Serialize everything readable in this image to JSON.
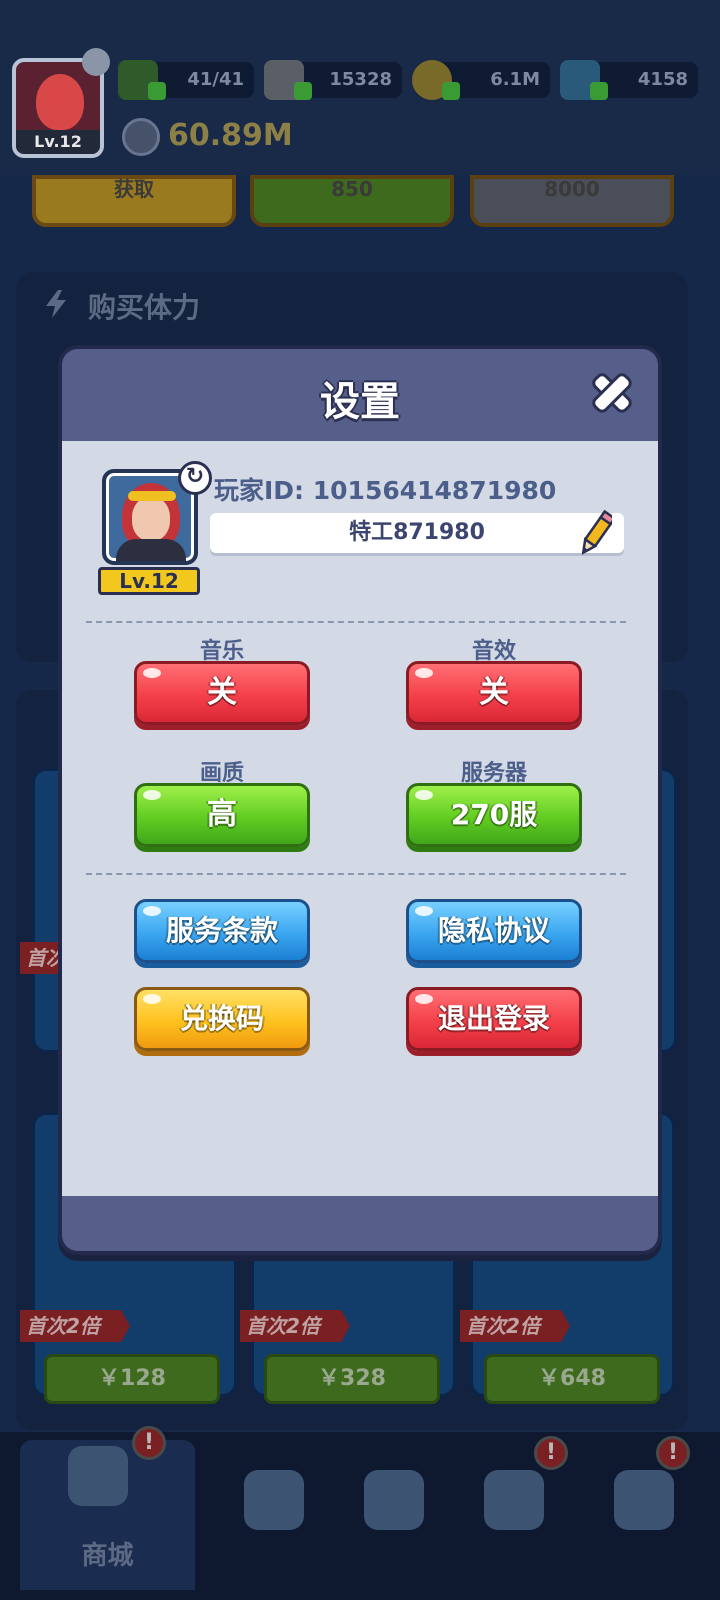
{
  "hud": {
    "avatar_level": "Lv.12",
    "energy": "41/41",
    "food": "15328",
    "coins": "6.1M",
    "gems": "4158",
    "power": "60.89M"
  },
  "shop": {
    "top_buttons": [
      "获取",
      "850",
      "8000"
    ],
    "section_title": "购买体力",
    "badges": [
      "首次2倍",
      "首次2倍",
      "首次2倍",
      "首次2倍"
    ],
    "prices": [
      "￥128",
      "￥328",
      "￥648"
    ]
  },
  "nav": {
    "active_label": "商城",
    "alert_mark": "!"
  },
  "settings": {
    "title": "设置",
    "player_id": "玩家ID: 10156414871980",
    "player_name": "特工871980",
    "level": "Lv.12",
    "music_label": "音乐",
    "music_value": "关",
    "sfx_label": "音效",
    "sfx_value": "关",
    "quality_label": "画质",
    "quality_value": "高",
    "server_label": "服务器",
    "server_value": "270服",
    "terms_button": "服务条款",
    "privacy_button": "隐私协议",
    "redeem_button": "兑换码",
    "logout_button": "退出登录"
  },
  "colors": {
    "dialog_header": "#565f8a",
    "dialog_body": "#d3d9e5",
    "toggle_off": "#f4404a",
    "toggle_on": "#62cc22",
    "link_button": "#3aa6f0",
    "redeem_button": "#ffc21e"
  },
  "icons": [
    "energy-icon",
    "food-icon",
    "coin-icon",
    "gem-icon",
    "power-icon",
    "close-icon",
    "swap-icon",
    "pencil-icon",
    "shop-icon",
    "hero-icon",
    "map-icon",
    "badge-icon",
    "target-icon"
  ]
}
